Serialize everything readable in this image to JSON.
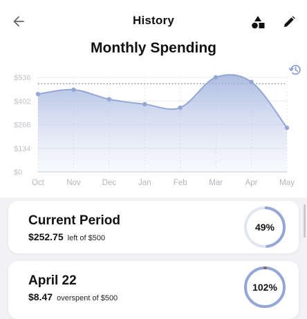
{
  "header": {
    "title": "History"
  },
  "icons": {
    "back": "arrow-left-icon",
    "shapes": "shapes-icon",
    "edit": "pencil-icon",
    "history": "history-clock-icon"
  },
  "colors": {
    "accent": "#94a6d4",
    "ring_track": "#e3e6f0",
    "over_budget_marker": "#8a6a78",
    "text": "#111111"
  },
  "chart_data": {
    "type": "area",
    "title": "Monthly Spending",
    "categories": [
      "Oct",
      "Nov",
      "Dec",
      "Jan",
      "Feb",
      "Mar",
      "Apr",
      "May"
    ],
    "values": [
      441,
      466,
      412,
      384,
      364,
      536,
      510,
      250
    ],
    "reference_line": 500,
    "ylim": [
      0,
      536
    ],
    "yticks": [
      "$536",
      "$402",
      "$268",
      "$134",
      "$0"
    ],
    "grid": true
  },
  "cards": [
    {
      "title": "Current Period",
      "amount": "$252.75",
      "note": "left of $500",
      "percent_label": "49%",
      "percent": 49
    },
    {
      "title": "April 22",
      "amount": "$8.47",
      "note": "overspent of $500",
      "percent_label": "102%",
      "percent": 102
    }
  ]
}
